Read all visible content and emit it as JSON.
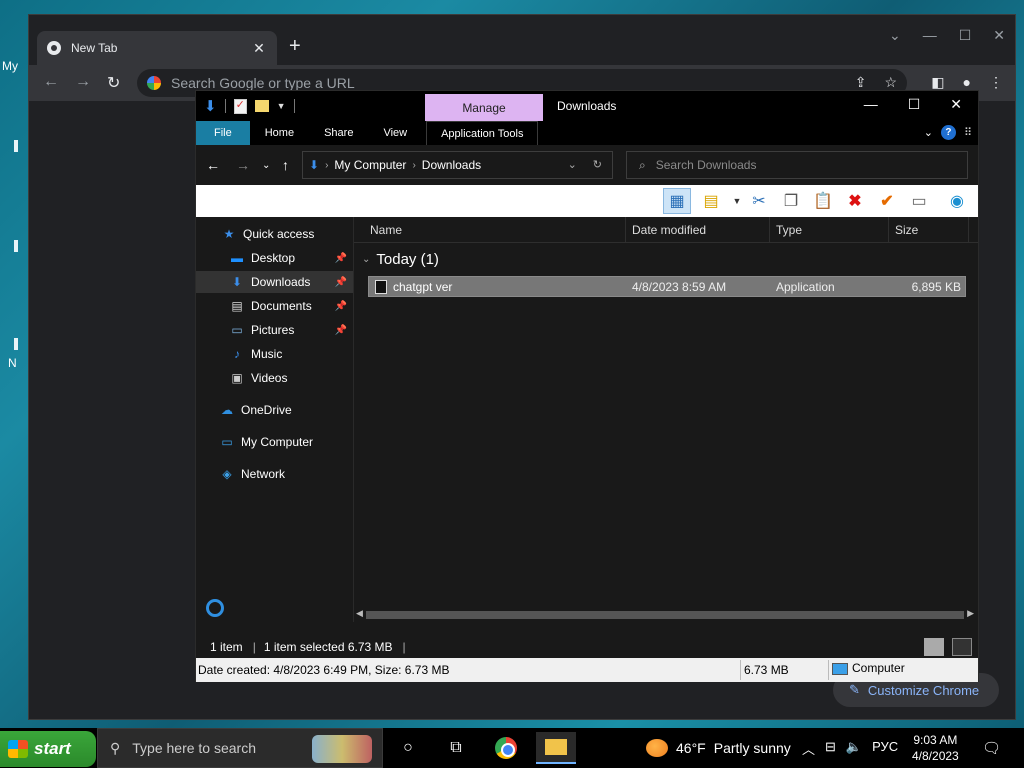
{
  "desktop": {
    "label_my": "My",
    "label_n": "N"
  },
  "chrome": {
    "tab_title": "New Tab",
    "tab_close": "✕",
    "new_tab": "+",
    "omnibox_placeholder": "Search Google or type a URL",
    "customize_label": "Customize Chrome",
    "back": "←",
    "forward": "→",
    "reload": "↻",
    "minimize": "—",
    "restore": "☐",
    "close": "✕",
    "dropdown": "⌄"
  },
  "explorer": {
    "title": "Downloads",
    "manage_tab": "Manage",
    "ribbon_tabs": {
      "file": "File",
      "home": "Home",
      "share": "Share",
      "view": "View",
      "app_tools": "Application Tools"
    },
    "help": "?",
    "breadcrumb": {
      "root": "My Computer",
      "current": "Downloads"
    },
    "search_placeholder": "Search Downloads",
    "nav": {
      "quick_access": "Quick access",
      "desktop": "Desktop",
      "downloads": "Downloads",
      "documents": "Documents",
      "pictures": "Pictures",
      "music": "Music",
      "videos": "Videos",
      "onedrive": "OneDrive",
      "my_computer": "My Computer",
      "network": "Network"
    },
    "columns": {
      "name": "Name",
      "date": "Date modified",
      "type": "Type",
      "size": "Size"
    },
    "group_label": "Today (1)",
    "files": [
      {
        "name": "chatgpt ver",
        "date": "4/8/2023 8:59 AM",
        "type": "Application",
        "size": "6,895 KB"
      }
    ],
    "status": {
      "items": "1 item",
      "selected": "1 item selected  6.73 MB"
    },
    "info": {
      "details": "Date created: 4/8/2023 6:49 PM, Size: 6.73 MB",
      "size": "6.73 MB",
      "location": "Computer"
    }
  },
  "taskbar": {
    "start_label": "start",
    "search_placeholder": "Type here to search",
    "weather_temp": "46°F",
    "weather_desc": "Partly sunny",
    "language": "РУС",
    "time": "9:03 AM",
    "date": "4/8/2023"
  },
  "icons": {
    "chrome_tab": "chrome-icon",
    "explorer_downloads": "download-arrow-icon",
    "taskbar_chrome": "chrome-icon",
    "taskbar_explorer": "folder-icon"
  },
  "colors": {
    "file_tab": "#1a7ea3",
    "manage_tab": "#ddb4f2",
    "start_green": "#2b8a2b",
    "selection": "#777777"
  }
}
